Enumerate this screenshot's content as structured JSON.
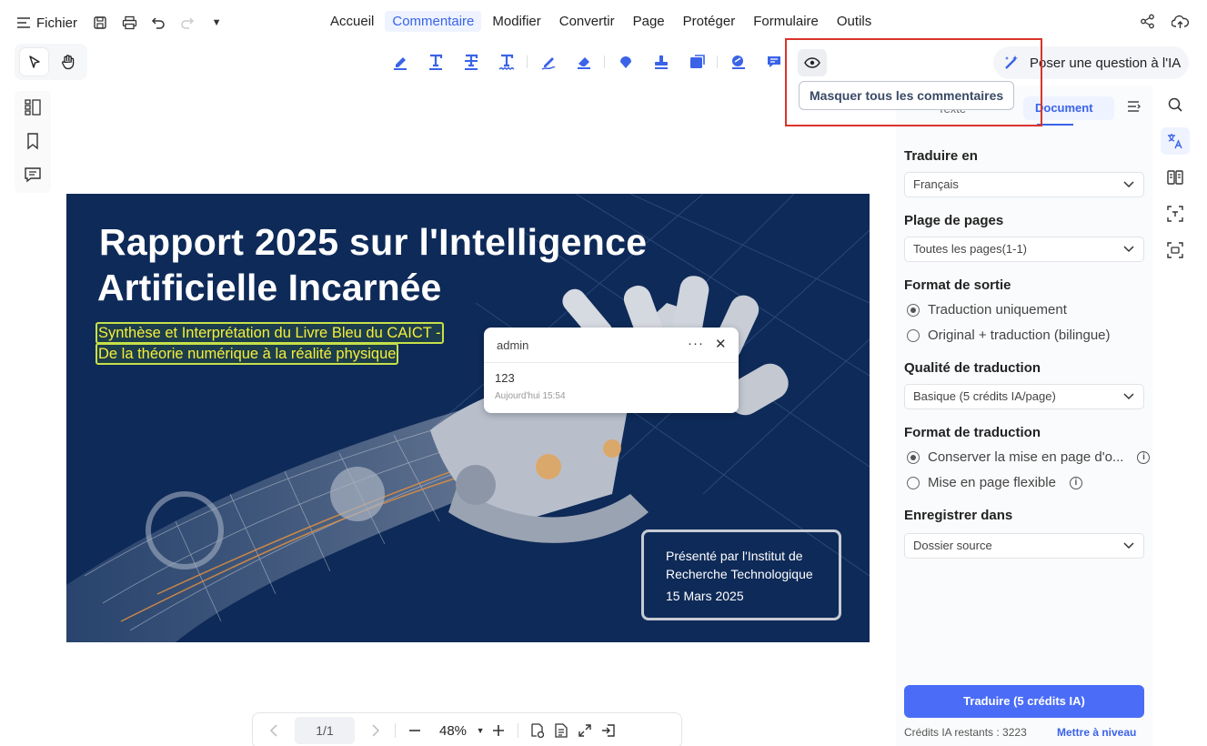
{
  "menubar": {
    "fichier_label": "Fichier",
    "items": [
      "Accueil",
      "Commentaire",
      "Modifier",
      "Convertir",
      "Page",
      "Protéger",
      "Formulaire",
      "Outils"
    ],
    "active_item": "Commentaire"
  },
  "ai": {
    "ask_label": "Poser une question à l'IA"
  },
  "tooltip": {
    "label": "Masquer tous les commentaires"
  },
  "document": {
    "title_line1": "Rapport 2025 sur l'Intelligence",
    "title_line2": "Artificielle Incarnée",
    "subtitle_line1": "Synthèse et Interprétation du Livre Bleu du CAICT -",
    "subtitle_line2": "De la théorie numérique à la réalité physique",
    "presenter_line1": "Présenté par l'Institut de",
    "presenter_line2": "Recherche Technologique",
    "date": "15 Mars 2025"
  },
  "comment": {
    "author": "admin",
    "more": "···",
    "close": "✕",
    "text": "123",
    "time": "Aujourd'hui 15:54"
  },
  "pagebar": {
    "page": "1/1",
    "zoom": "48%"
  },
  "panel": {
    "tab_text": "Texte",
    "tab_document": "Document",
    "translate_to_label": "Traduire en",
    "translate_to_value": "Français",
    "page_range_label": "Plage de pages",
    "page_range_value": "Toutes les pages(1-1)",
    "output_format_label": "Format de sortie",
    "output_opt1": "Traduction uniquement",
    "output_opt2": "Original + traduction (bilingue)",
    "quality_label": "Qualité de traduction",
    "quality_value": "Basique (5 crédits IA/page)",
    "trans_format_label": "Format de traduction",
    "trans_opt1": "Conserver la mise en page d'o...",
    "trans_opt2": "Mise en page flexible",
    "save_label": "Enregistrer dans",
    "save_value": "Dossier source",
    "translate_button": "Traduire (5 crédits IA)",
    "credits": "Crédits IA restants : 3223",
    "upgrade": "Mettre à niveau"
  },
  "colors": {
    "accent": "#3a63e8",
    "button": "#4a6cf7",
    "doc_bg": "#0e2a58",
    "highlight_text": "#f5ef3a",
    "red_frame": "#d9342b"
  }
}
